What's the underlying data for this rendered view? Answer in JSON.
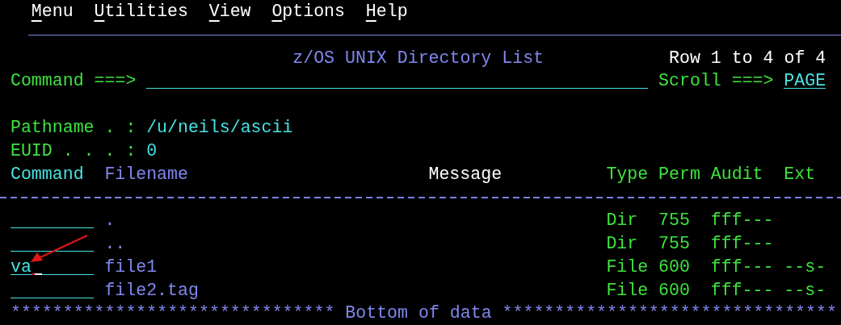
{
  "menu": [
    {
      "label": "Menu"
    },
    {
      "label": "Utilities"
    },
    {
      "label": "View"
    },
    {
      "label": "Options"
    },
    {
      "label": "Help"
    }
  ],
  "title": "z/OS UNIX Directory List",
  "row_info": "Row 1 to 4 of 4",
  "command_prompt": "Command ===>",
  "scroll": {
    "label": "Scroll ===>",
    "value": "PAGE"
  },
  "pathname": {
    "label": "Pathname . :",
    "value": "/u/neils/ascii"
  },
  "euid": {
    "label": "EUID . . . :",
    "value": "0"
  },
  "columns": [
    "Command",
    "Filename",
    "Message",
    "Type",
    "Perm",
    "Audit",
    "Ext"
  ],
  "rows": [
    {
      "filename": ".",
      "type": "Dir",
      "perm": "755",
      "audit": "fff---",
      "cursor": false
    },
    {
      "filename": "..",
      "type": "Dir",
      "perm": "755",
      "audit": "fff---",
      "cursor": false
    },
    {
      "command": "va",
      "filename": "file1",
      "type": "File",
      "perm": "600",
      "audit": "fff---",
      "ext": "--s-",
      "cursor": true
    },
    {
      "filename": "file2.tag",
      "type": "File",
      "perm": "600",
      "audit": "fff---",
      "ext": "--s-",
      "cursor": false
    }
  ],
  "footer": "******************************* Bottom of data ********************************"
}
